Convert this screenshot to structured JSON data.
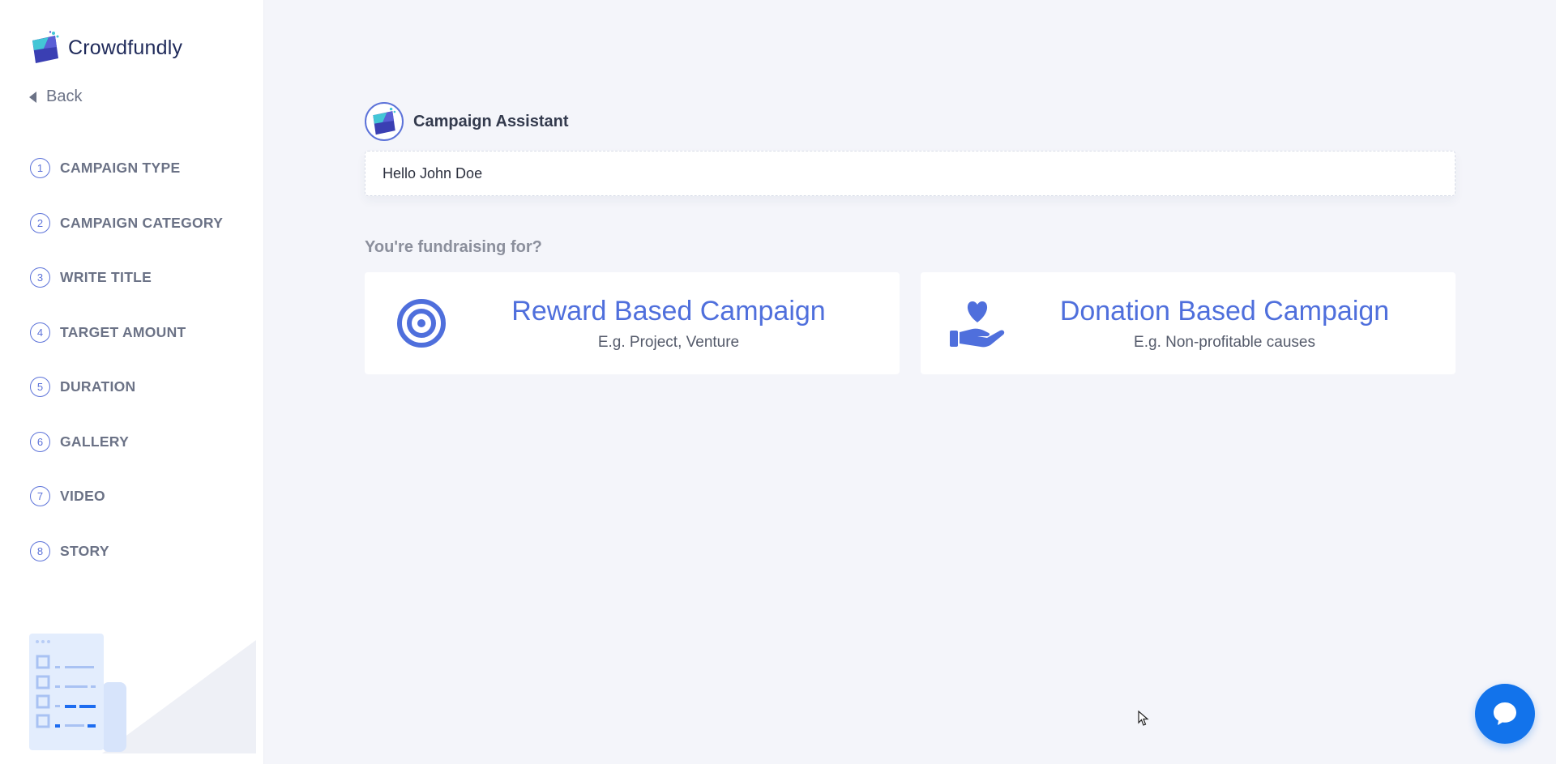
{
  "brand": {
    "name": "Crowdfundly"
  },
  "sidebar": {
    "back_label": "Back",
    "steps": [
      {
        "num": "1",
        "label": "CAMPAIGN TYPE"
      },
      {
        "num": "2",
        "label": "CAMPAIGN CATEGORY"
      },
      {
        "num": "3",
        "label": "WRITE TITLE"
      },
      {
        "num": "4",
        "label": "TARGET AMOUNT"
      },
      {
        "num": "5",
        "label": "DURATION"
      },
      {
        "num": "6",
        "label": "GALLERY"
      },
      {
        "num": "7",
        "label": "VIDEO"
      },
      {
        "num": "8",
        "label": "STORY"
      }
    ]
  },
  "assistant": {
    "name": "Campaign Assistant",
    "message": "Hello John Doe"
  },
  "question": "You're fundraising for?",
  "options": {
    "reward": {
      "title": "Reward Based Campaign",
      "subtitle": "E.g. Project, Venture",
      "icon": "target-icon"
    },
    "donation": {
      "title": "Donation Based Campaign",
      "subtitle": "E.g. Non-profitable causes",
      "icon": "heart-hand-icon"
    }
  },
  "colors": {
    "accent": "#4f6fdc",
    "chat": "#1273eb",
    "background": "#f4f5fa"
  }
}
